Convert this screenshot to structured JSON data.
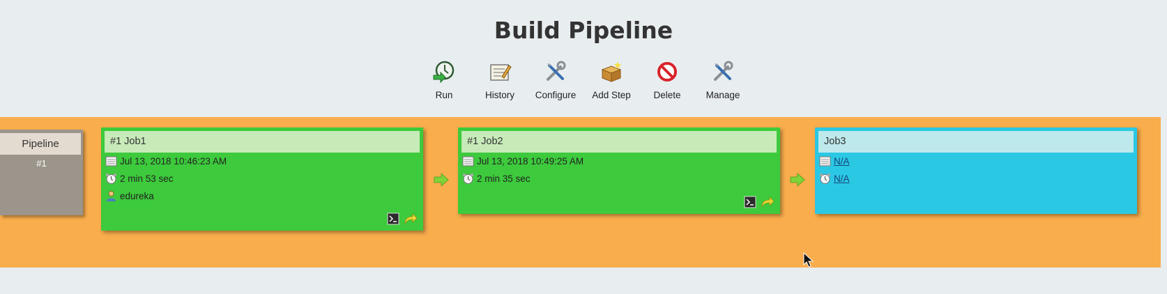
{
  "page": {
    "title": "Build Pipeline"
  },
  "toolbar": {
    "items": [
      {
        "label": "Run",
        "icon": "run-icon"
      },
      {
        "label": "History",
        "icon": "history-icon"
      },
      {
        "label": "Configure",
        "icon": "configure-icon"
      },
      {
        "label": "Add Step",
        "icon": "add-step-icon"
      },
      {
        "label": "Delete",
        "icon": "delete-icon"
      },
      {
        "label": "Manage",
        "icon": "manage-icon"
      }
    ]
  },
  "pipeline": {
    "label": "Pipeline",
    "number": "#1",
    "band_color": "#f9ad4c"
  },
  "jobs": [
    {
      "title": "#1 Job1",
      "status_color": "#3dca3c",
      "date": "Jul 13, 2018 10:46:23 AM",
      "duration": "2 min 53 sec",
      "user": "edureka"
    },
    {
      "title": "#1 Job2",
      "status_color": "#3dca3c",
      "date": "Jul 13, 2018 10:49:25 AM",
      "duration": "2 min 35 sec"
    },
    {
      "title": "Job3",
      "status_color": "#2bc8e4",
      "date": "N/A",
      "duration": "N/A"
    }
  ]
}
